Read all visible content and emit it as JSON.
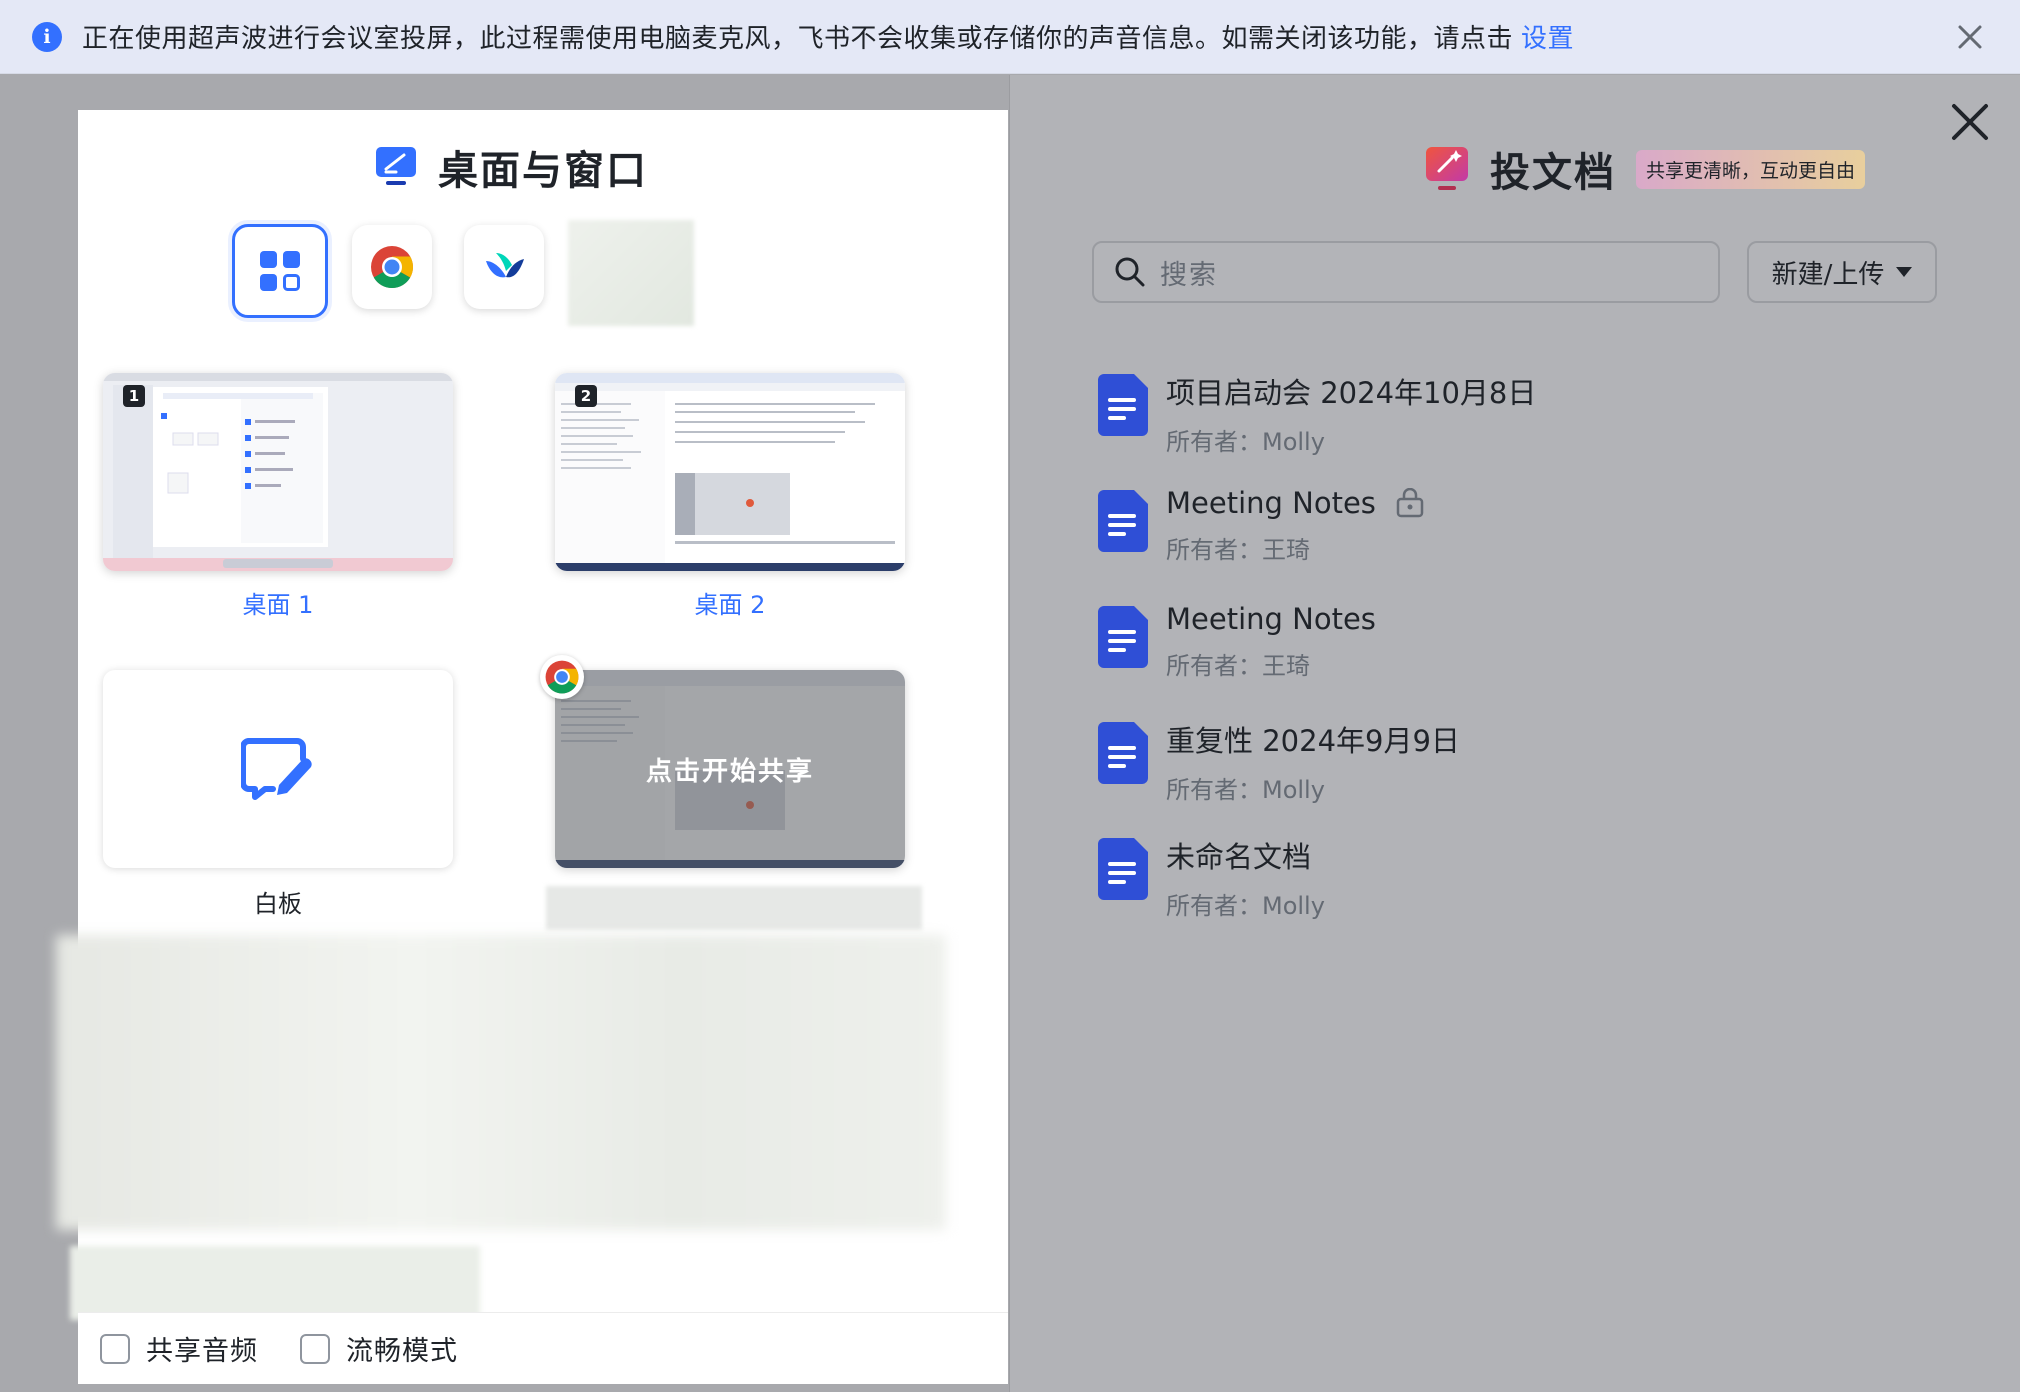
{
  "banner": {
    "message": "正在使用超声波进行会议室投屏，此过程需使用电脑麦克风，飞书不会收集或存储你的声音信息。如需关闭该功能，请点击",
    "link": "设置"
  },
  "left": {
    "title": "桌面与窗口",
    "desktops": [
      {
        "label": "桌面 1",
        "number": "1"
      },
      {
        "label": "桌面 2",
        "number": "2"
      }
    ],
    "whiteboard_label": "白板",
    "chrome_window_overlay": "点击开始共享",
    "options": [
      {
        "label": "共享音频",
        "checked": false
      },
      {
        "label": "流畅模式",
        "checked": false
      }
    ]
  },
  "right": {
    "title": "投文档",
    "badge": "共享更清晰，互动更自由",
    "search_placeholder": "搜索",
    "new_upload_label": "新建/上传",
    "documents": [
      {
        "name": "项目启动会 2024年10月8日",
        "owner": "所有者：Molly",
        "locked": false
      },
      {
        "name": "Meeting Notes",
        "owner": "所有者：王琦",
        "locked": true
      },
      {
        "name": "Meeting Notes",
        "owner": "所有者：王琦",
        "locked": false
      },
      {
        "name": "重复性 2024年9月9日",
        "owner": "所有者：Molly",
        "locked": false
      },
      {
        "name": "未命名文档",
        "owner": "所有者：Molly",
        "locked": false
      }
    ]
  },
  "colors": {
    "accent": "#3370ff",
    "doc_icon": "#2f4fd6",
    "panel_bg": "#ffffff",
    "dim_bg": "#a8a9ad"
  }
}
